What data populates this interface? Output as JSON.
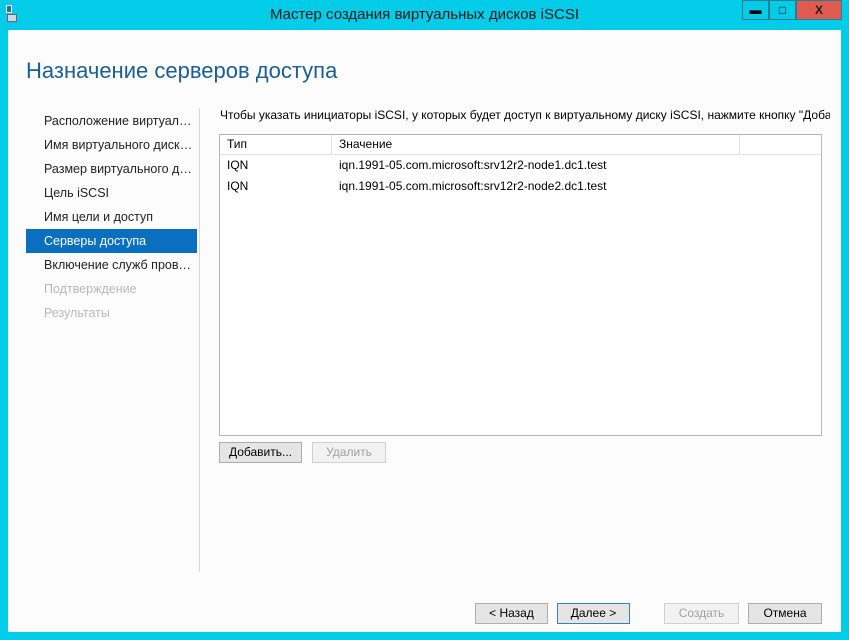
{
  "window": {
    "title": "Мастер создания виртуальных дисков iSCSI",
    "min": "▬",
    "max": "□",
    "close": "X"
  },
  "heading": "Назначение серверов доступа",
  "nav": [
    {
      "label": "Расположение виртуального диска iSCSI",
      "state": "normal"
    },
    {
      "label": "Имя виртуального диска iSCSI",
      "state": "normal"
    },
    {
      "label": "Размер виртуального диска iSCSI",
      "state": "normal"
    },
    {
      "label": "Цель iSCSI",
      "state": "normal"
    },
    {
      "label": "Имя цели и доступ",
      "state": "normal"
    },
    {
      "label": "Серверы доступа",
      "state": "selected"
    },
    {
      "label": "Включение служб проверки подлинности",
      "state": "normal"
    },
    {
      "label": "Подтверждение",
      "state": "disabled"
    },
    {
      "label": "Результаты",
      "state": "disabled"
    }
  ],
  "description": "Чтобы указать инициаторы iSCSI, у которых будет доступ к виртуальному диску iSCSI, нажмите кнопку \"Добавить\".",
  "table": {
    "headers": [
      "Тип",
      "Значение"
    ],
    "rows": [
      [
        "IQN",
        "iqn.1991-05.com.microsoft:srv12r2-node1.dc1.test"
      ],
      [
        "IQN",
        "iqn.1991-05.com.microsoft:srv12r2-node2.dc1.test"
      ]
    ]
  },
  "buttons": {
    "add": "Добавить...",
    "remove": "Удалить",
    "back": "< Назад",
    "next": "Далее >",
    "create": "Создать",
    "cancel": "Отмена"
  }
}
